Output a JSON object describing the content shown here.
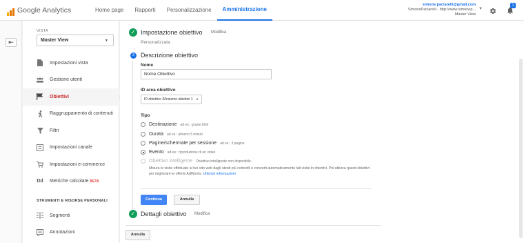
{
  "app": {
    "brand": "Google Analytics",
    "brand_colors": [
      "#f9ab00",
      "#e37400"
    ]
  },
  "nav": {
    "items": [
      "Home page",
      "Rapporti",
      "Personalizzazione",
      "Amministrazione"
    ],
    "active": "Amministrazione"
  },
  "account": {
    "email": "simone.paciarelli@gmail.com",
    "property": "SimonePaciarelli - http://www.simonep...",
    "view": "Master View",
    "notifications": "1"
  },
  "sidebar": {
    "vista_label": "VISTA",
    "vista_value": "Master View",
    "items": [
      {
        "label": "Impostazioni vista",
        "icon": "document-icon"
      },
      {
        "label": "Gestione utenti",
        "icon": "users-icon"
      },
      {
        "label": "Obiettivi",
        "icon": "flag-icon",
        "active": true
      },
      {
        "label": "Raggruppamento di contenuti",
        "icon": "person-walk-icon"
      },
      {
        "label": "Filtri",
        "icon": "filter-icon"
      },
      {
        "label": "Impostazioni canale",
        "icon": "channel-icon"
      },
      {
        "label": "Impostazioni e-commerce",
        "icon": "cart-icon"
      },
      {
        "label": "Metriche calcolate",
        "icon": "dd-icon",
        "badge": "BETA"
      }
    ],
    "section_title": "STRUMENTI E RISORSE PERSONALI",
    "items2": [
      {
        "label": "Segmenti",
        "icon": "segments-icon"
      },
      {
        "label": "Annotazioni",
        "icon": "annotation-icon"
      }
    ]
  },
  "steps": {
    "step1": {
      "title": "Impostazione obiettivo",
      "edit": "Modifica",
      "sub": "Personalizzata"
    },
    "step2": {
      "number": "2",
      "title": "Descrizione obiettivo",
      "name_label": "Nome",
      "name_value": "Nome Obiettivo",
      "id_label": "ID area obiettivo",
      "id_value": "ID obiettivo 3/Insieme obiettivi 1",
      "type_label": "Tipo",
      "types": [
        {
          "label": "Destinazione",
          "example": "ad es.: grazie.html",
          "checked": false,
          "disabled": false
        },
        {
          "label": "Durata",
          "example": "ad es.: almeno 5 minuti",
          "checked": false,
          "disabled": false
        },
        {
          "label": "Pagine/schermate per sessione",
          "example": "ad es.: 3 pagine",
          "checked": false,
          "disabled": false
        },
        {
          "label": "Evento",
          "example": "ad es.: riproduzione di un video",
          "checked": true,
          "disabled": false
        },
        {
          "label": "Obiettivo intelligente",
          "example": "Obiettivo intelligente non disponibile.",
          "checked": false,
          "disabled": true
        }
      ],
      "smart_note": "Misura le visite effettuate al tuo sito web dagli utenti più coinvolti e converti automaticamente tali visite in obiettivi. Poi utilizza questi obiettivi per migliorare le offerte AdWords.",
      "smart_link": "Ulteriori informazioni",
      "continue_label": "Continua",
      "cancel_label": "Annulla"
    },
    "step3": {
      "title": "Dettagli obiettivo",
      "edit": "Modifica"
    },
    "footer_cancel": "Annulla"
  }
}
